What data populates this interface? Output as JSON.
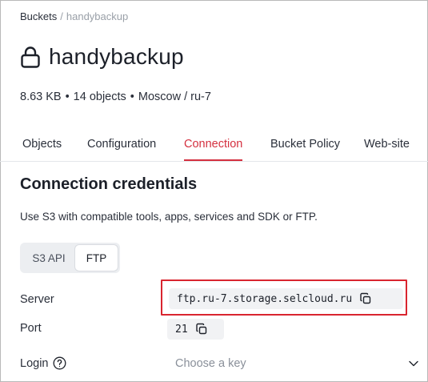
{
  "breadcrumb": {
    "root": "Buckets",
    "separator": "/",
    "current": "handybackup"
  },
  "bucket": {
    "name": "handybackup",
    "size": "8.63 KB",
    "objects": "14 objects",
    "location": "Moscow / ru-7",
    "meta_separator": "•"
  },
  "tabs": [
    "Objects",
    "Configuration",
    "Connection",
    "Bucket Policy",
    "Web-site"
  ],
  "active_tab": "Connection",
  "section": {
    "title": "Connection credentials",
    "description": "Use S3 with compatible tools, apps, services and SDK or FTP."
  },
  "protocol_toggle": {
    "options": [
      "S3 API",
      "FTP"
    ],
    "selected": "FTP"
  },
  "fields": {
    "server": {
      "label": "Server",
      "value": "ftp.ru-7.storage.selcloud.ru"
    },
    "port": {
      "label": "Port",
      "value": "21"
    },
    "login": {
      "label": "Login",
      "placeholder": "Choose a key"
    }
  },
  "icons": {
    "title": "lock-icon",
    "copy": "copy-icon",
    "help": "help-circle-icon",
    "dropdown": "chevron-down-icon"
  },
  "colors": {
    "accent": "#d4303f",
    "highlight_border": "#d9252f",
    "value_bg": "#f1f2f4",
    "toggle_bg": "#eceef1"
  }
}
